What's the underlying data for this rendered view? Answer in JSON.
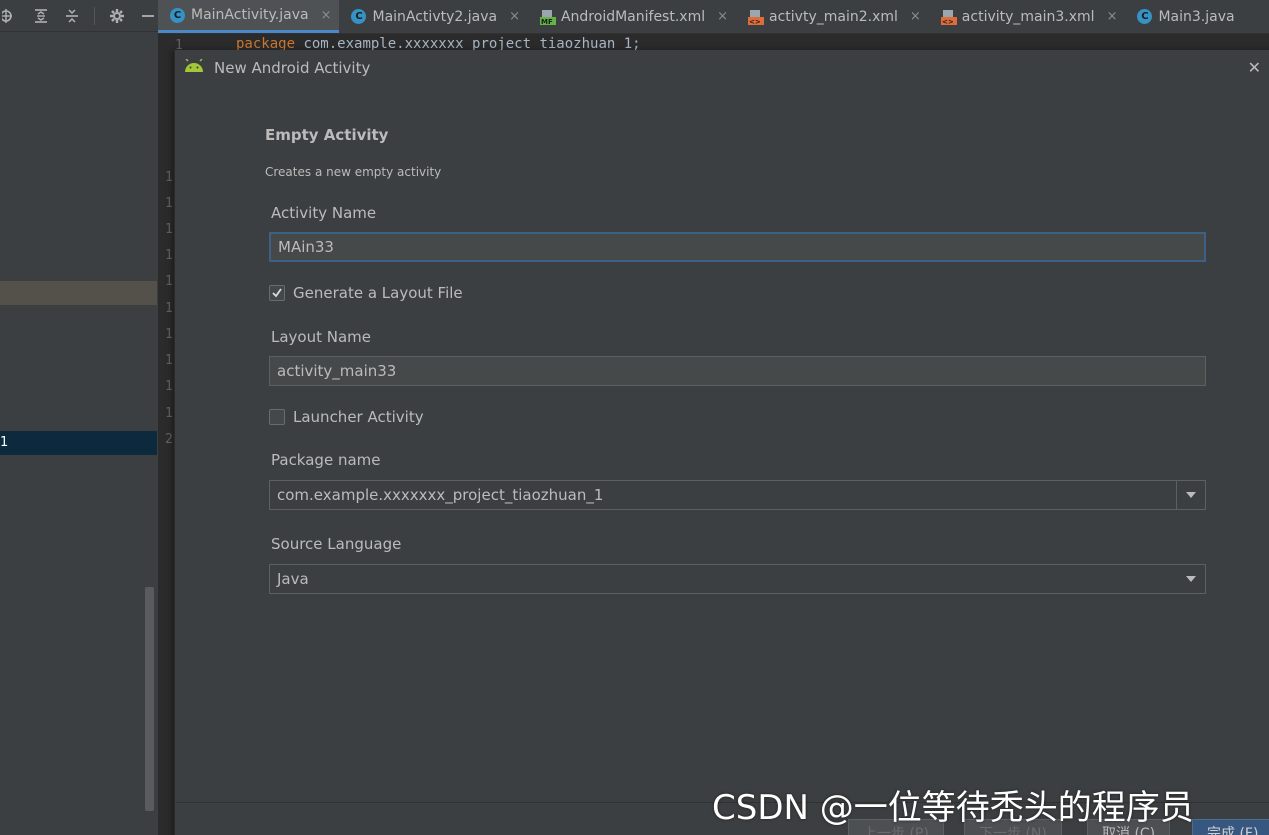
{
  "tabs": [
    {
      "label": "MainActivity.java",
      "icon": "java-class-icon",
      "active": true
    },
    {
      "label": "MainActivty2.java",
      "icon": "java-class-icon",
      "active": false
    },
    {
      "label": "AndroidManifest.xml",
      "icon": "manifest-icon",
      "active": false
    },
    {
      "label": "activty_main2.xml",
      "icon": "layout-xml-icon",
      "active": false
    },
    {
      "label": "activity_main3.xml",
      "icon": "layout-xml-icon",
      "active": false
    },
    {
      "label": "Main3.java",
      "icon": "java-class-icon",
      "active": false
    }
  ],
  "tab_close_glyph": "×",
  "editor": {
    "first_line_number": "1",
    "code_keyword": "package",
    "code_rest": " com.example.xxxxxxx_project_tiaozhuan_1;",
    "gutter_numbers": [
      "1",
      "1",
      "1",
      "1",
      "1",
      "1",
      "1",
      "1",
      "1",
      "1",
      "2"
    ]
  },
  "left_panel": {
    "selected_row_text": "1"
  },
  "dialog": {
    "title": "New Android Activity",
    "heading": "Empty Activity",
    "subheading": "Creates a new empty activity",
    "activity_name_label": "Activity Name",
    "activity_name_value": "MAin33",
    "generate_layout_label": "Generate a Layout File",
    "generate_layout_checked": true,
    "layout_name_label": "Layout Name",
    "layout_name_value": "activity_main33",
    "launcher_label": "Launcher Activity",
    "launcher_checked": false,
    "package_label": "Package name",
    "package_value": "com.example.xxxxxxx_project_tiaozhuan_1",
    "source_language_label": "Source Language",
    "source_language_value": "Java",
    "buttons": {
      "previous": "上一步 (P)",
      "next": "下一步 (N)",
      "cancel": "取消 (C)",
      "finish": "完成 (F)"
    }
  },
  "watermark": "CSDN @一位等待秃头的程序员",
  "colors": {
    "accent": "#4a88c7",
    "android_green": "#a4c639",
    "java_badge": "#3592c4"
  }
}
